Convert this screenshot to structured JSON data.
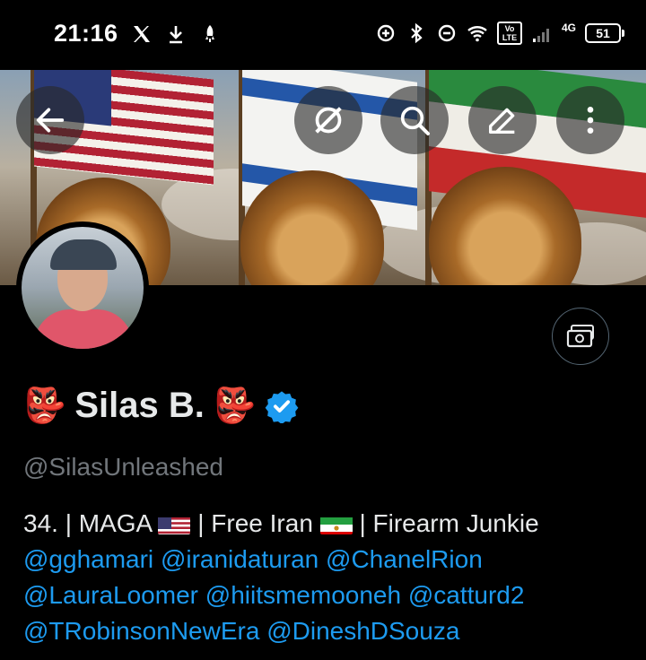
{
  "status_bar": {
    "time": "21:16",
    "network": "4G",
    "volte": "Vo LTE",
    "battery": "51"
  },
  "header": {
    "back_icon": "arrow-left-icon",
    "buttons": [
      "grok-icon",
      "search-icon",
      "edit-icon",
      "more-vertical-icon"
    ]
  },
  "profile": {
    "name": "Silas B.",
    "name_emoji": "👺",
    "verified_color": "#1d9bf0",
    "handle": "@SilasUnleashed",
    "bio_prefix": "34. | MAGA",
    "bio_sep1": " | Free Iran",
    "bio_sep2": " | Firearm Junkie",
    "mentions_line1": [
      "@gghamari",
      "@iranidaturan",
      "@ChanelRion"
    ],
    "mentions_line2": [
      "@LauraLoomer",
      "@hiitsmemooneh",
      "@catturd2"
    ],
    "mentions_line3": [
      "@TRobinsonNewEra",
      "@DineshDSouza"
    ]
  },
  "colors": {
    "background": "#000000",
    "text": "#e7e9ea",
    "muted": "#71767b",
    "link": "#1d9bf0"
  }
}
